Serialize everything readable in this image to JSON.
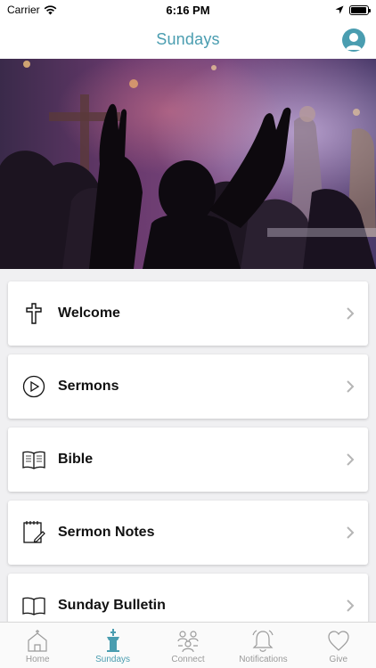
{
  "status_bar": {
    "carrier": "Carrier",
    "time": "6:16 PM",
    "battery_level": 0.95
  },
  "nav": {
    "title": "Sundays",
    "profile_icon": "person-icon"
  },
  "hero": {
    "image": "worship-crowd-photo"
  },
  "menu": {
    "items": [
      {
        "label": "Welcome",
        "icon": "cross-icon"
      },
      {
        "label": "Sermons",
        "icon": "play-circle-icon"
      },
      {
        "label": "Bible",
        "icon": "open-book-icon"
      },
      {
        "label": "Sermon Notes",
        "icon": "notepad-icon"
      },
      {
        "label": "Sunday Bulletin",
        "icon": "book-icon"
      }
    ]
  },
  "tabs": {
    "items": [
      {
        "label": "Home",
        "icon": "church-icon",
        "active": false
      },
      {
        "label": "Sundays",
        "icon": "pulpit-icon",
        "active": true
      },
      {
        "label": "Connect",
        "icon": "group-icon",
        "active": false
      },
      {
        "label": "Notifications",
        "icon": "bell-icon",
        "active": false
      },
      {
        "label": "Give",
        "icon": "heart-icon",
        "active": false
      }
    ]
  },
  "colors": {
    "accent": "#4a9db0",
    "inactive": "#9a9a9a"
  }
}
